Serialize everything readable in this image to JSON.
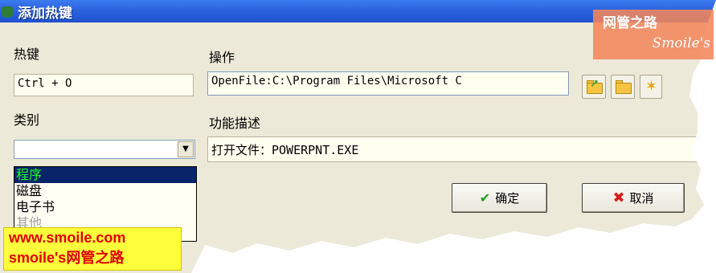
{
  "window": {
    "title": "添加热键"
  },
  "labels": {
    "hotkey": "热键",
    "action": "操作",
    "category": "类别",
    "description": "功能描述"
  },
  "fields": {
    "hotkey_value": "Ctrl + O",
    "action_value": "OpenFile:C:\\Program Files\\Microsoft C",
    "description_value": "打开文件：POWERPNT.EXE",
    "category_value": ""
  },
  "category_options": [
    {
      "label": "程序",
      "selected": true
    },
    {
      "label": "磁盘",
      "selected": false
    },
    {
      "label": "电子书",
      "selected": false
    },
    {
      "label": "其他",
      "selected": false
    }
  ],
  "buttons": {
    "ok": "确定",
    "cancel": "取消"
  },
  "icons": {
    "open_file": "folder-open-icon",
    "folder": "folder-icon",
    "wizard": "wand-icon",
    "ok": "checkmark-icon",
    "cancel": "x-icon"
  },
  "watermarks": {
    "top_right_cn": "网管之路",
    "top_right_en": "Smoile's",
    "bottom_url": "www.smoile.com",
    "bottom_text": "smoile's网管之路"
  },
  "colors": {
    "title_bar": "#2c62de",
    "selection_bg": "#0a246a",
    "selection_text": "#1fff1f"
  }
}
